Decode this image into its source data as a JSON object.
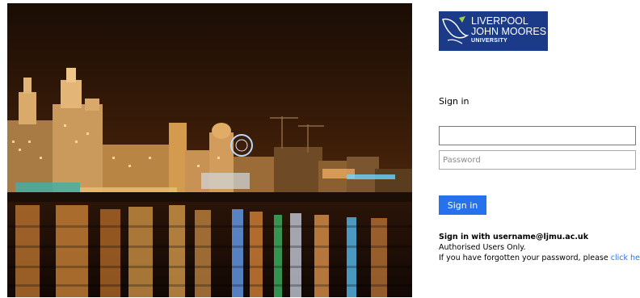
{
  "logo": {
    "line1": "LIVERPOOL",
    "line2": "JOHN MOORES",
    "line3": "UNIVERSITY",
    "background": "#1b3a87"
  },
  "signin": {
    "title": "Sign in",
    "username_value": "",
    "password_placeholder": "Password",
    "button_label": "Sign in",
    "button_color": "#2672ec"
  },
  "notice": {
    "heading": "Sign in with username@ljmu.ac.uk",
    "line1": "Authorised Users Only.",
    "line2_prefix": "If you have forgotten your password, please ",
    "link_label": "click here",
    "link_color": "#2672ec"
  },
  "illustration": {
    "subject": "Liverpool waterfront at night"
  }
}
